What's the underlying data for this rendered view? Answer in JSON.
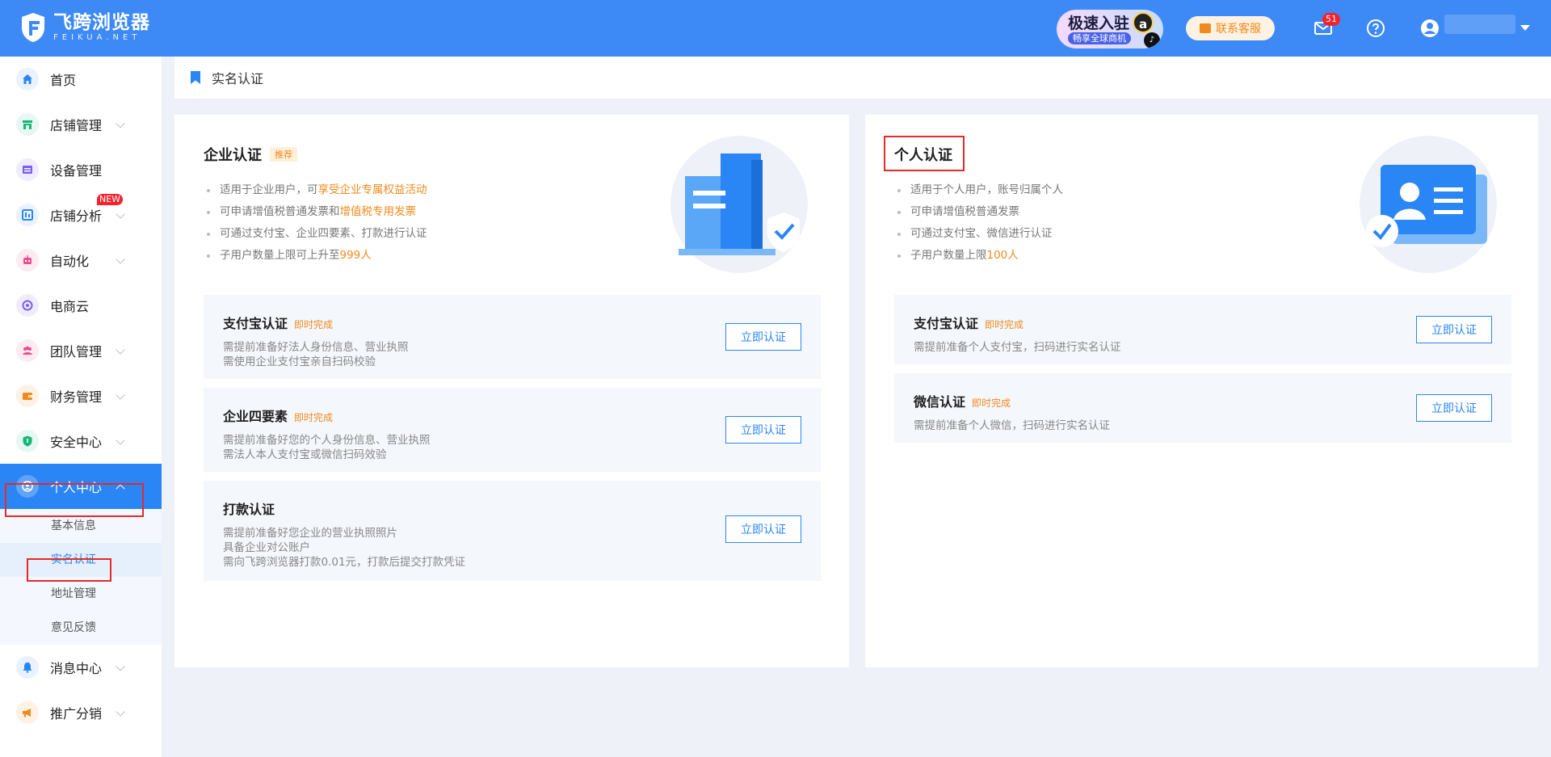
{
  "header": {
    "logo_cn": "飞跨浏览器",
    "logo_en": "FEIKUA.NET",
    "promo_title": "极速入驻",
    "promo_sub": "畅享全球商机",
    "service_label": "联系客服",
    "mail_badge": "51"
  },
  "sidebar": {
    "items": [
      {
        "label": "首页",
        "icon": "home-icon",
        "color": "#2a86f5"
      },
      {
        "label": "店铺管理",
        "icon": "store-icon",
        "color": "#16b87a"
      },
      {
        "label": "设备管理",
        "icon": "device-icon",
        "color": "#7b5cf5"
      },
      {
        "label": "店铺分析",
        "icon": "analytics-icon",
        "color": "#2a86f5",
        "badge": "NEW"
      },
      {
        "label": "自动化",
        "icon": "robot-icon",
        "color": "#e94c8a"
      },
      {
        "label": "电商云",
        "icon": "cloud-icon",
        "color": "#7b5cf5"
      },
      {
        "label": "团队管理",
        "icon": "team-icon",
        "color": "#e94c8a"
      },
      {
        "label": "财务管理",
        "icon": "wallet-icon",
        "color": "#f08a1c"
      },
      {
        "label": "安全中心",
        "icon": "shield-icon",
        "color": "#16b87a"
      },
      {
        "label": "个人中心",
        "icon": "user-icon",
        "color": "#ffffff"
      },
      {
        "label": "消息中心",
        "icon": "bell-icon",
        "color": "#2a86f5"
      },
      {
        "label": "推广分销",
        "icon": "megaphone-icon",
        "color": "#f08a1c"
      }
    ],
    "sub_items": [
      "基本信息",
      "实名认证",
      "地址管理",
      "意见反馈"
    ]
  },
  "breadcrumb": {
    "label": "实名认证"
  },
  "enterprise": {
    "title": "企业认证",
    "tag": "推荐",
    "bullets": [
      {
        "text": "适用于企业用户，可",
        "highlight": "享受企业专属权益活动"
      },
      {
        "text": "可申请增值税普通发票和",
        "highlight": "增值税专用发票"
      },
      {
        "text": "可通过支付宝、企业四要素、打款进行认证",
        "highlight": ""
      },
      {
        "text": "子用户数量上限可上升至",
        "highlight": "999人"
      }
    ],
    "methods": [
      {
        "title": "支付宝认证",
        "tag": "即时完成",
        "desc": [
          "需提前准备好法人身份信息、营业执照",
          "需使用企业支付宝亲自扫码校验"
        ],
        "button": "立即认证"
      },
      {
        "title": "企业四要素",
        "tag": "即时完成",
        "desc": [
          "需提前准备好您的个人身份信息、营业执照",
          "需法人本人支付宝或微信扫码效验"
        ],
        "button": "立即认证"
      },
      {
        "title": "打款认证",
        "tag": "",
        "desc": [
          "需提前准备好您企业的营业执照照片",
          "具备企业对公账户",
          "需向飞跨浏览器打款0.01元，打款后提交打款凭证"
        ],
        "button": "立即认证"
      }
    ]
  },
  "personal": {
    "title": "个人认证",
    "bullets": [
      {
        "text": "适用于个人用户，账号归属个人",
        "highlight": ""
      },
      {
        "text": "可申请增值税普通发票",
        "highlight": ""
      },
      {
        "text": "可通过支付宝、微信进行认证",
        "highlight": ""
      },
      {
        "text": "子用户数量上限",
        "highlight": "100人"
      }
    ],
    "methods": [
      {
        "title": "支付宝认证",
        "tag": "即时完成",
        "desc": [
          "需提前准备个人支付宝，扫码进行实名认证"
        ],
        "button": "立即认证"
      },
      {
        "title": "微信认证",
        "tag": "即时完成",
        "desc": [
          "需提前准备个人微信，扫码进行实名认证"
        ],
        "button": "立即认证"
      }
    ]
  },
  "colors": {
    "primary": "#2a86f5",
    "header": "#3d8af6",
    "accent": "#f08a1c",
    "highlight_box": "#e52a2a"
  }
}
